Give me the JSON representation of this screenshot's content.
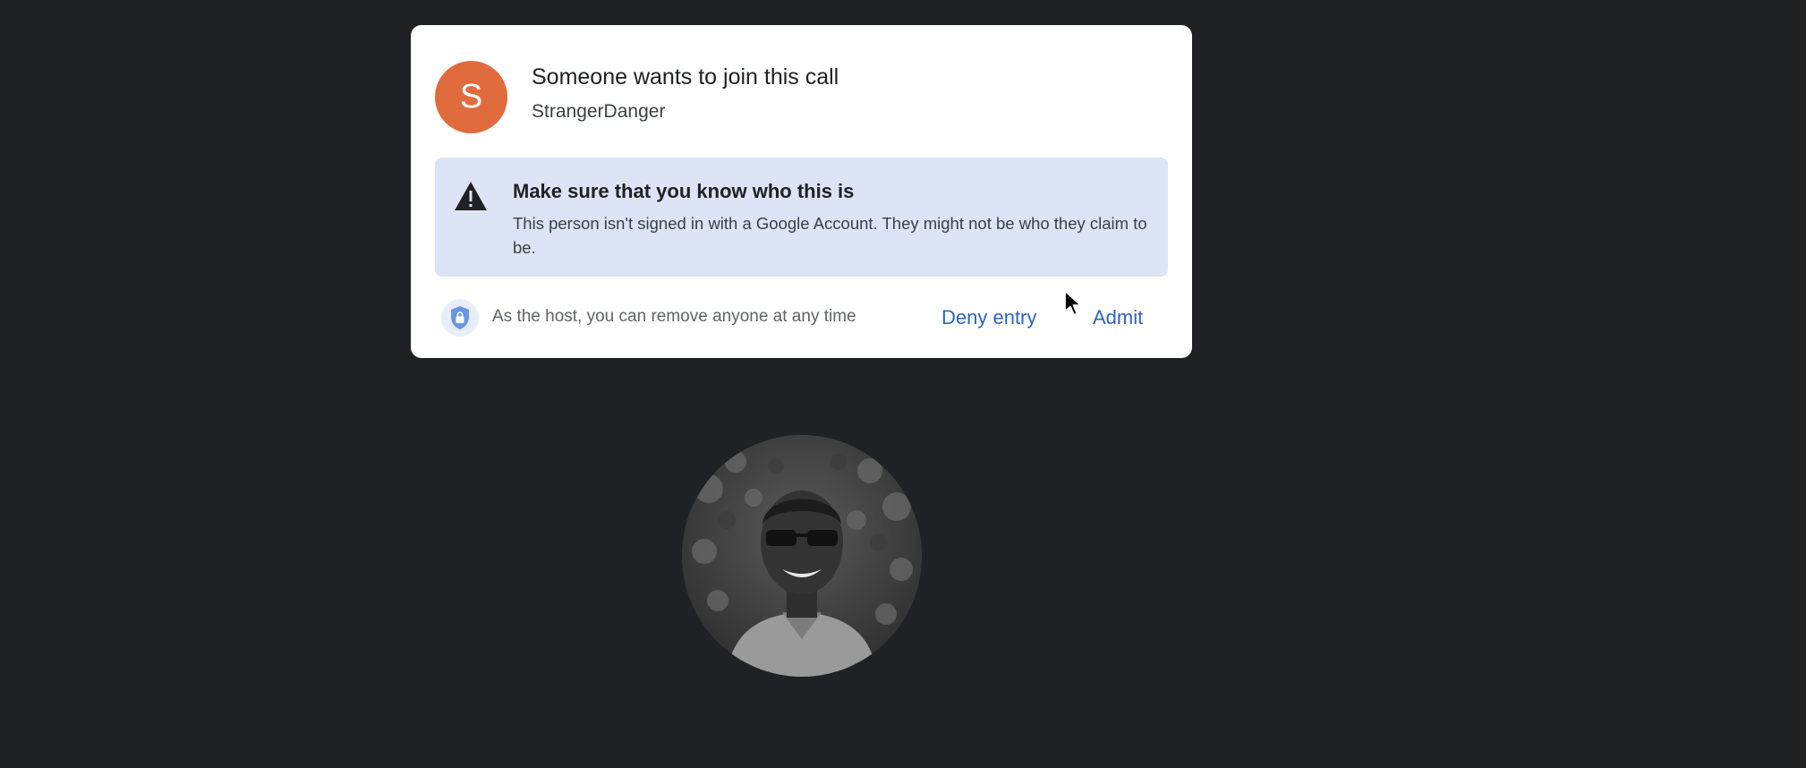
{
  "join_request": {
    "avatar_letter": "S",
    "title": "Someone wants to join this call",
    "requester_name": "StrangerDanger",
    "warning_title": "Make sure that you know who this is",
    "warning_body": "This person isn't signed in with a Google Account. They might not be who they claim to be.",
    "host_note": "As the host, you can remove anyone at any time",
    "deny_label": "Deny entry",
    "admit_label": "Admit",
    "icons": {
      "warning": "warning-triangle-icon",
      "shield": "shield-lock-icon",
      "cursor": "mouse-pointer-icon"
    },
    "colors": {
      "avatar_bg": "#e06b3d",
      "warning_bg": "#dce4f6",
      "action_text": "#2f64b8",
      "background": "#202124"
    }
  }
}
